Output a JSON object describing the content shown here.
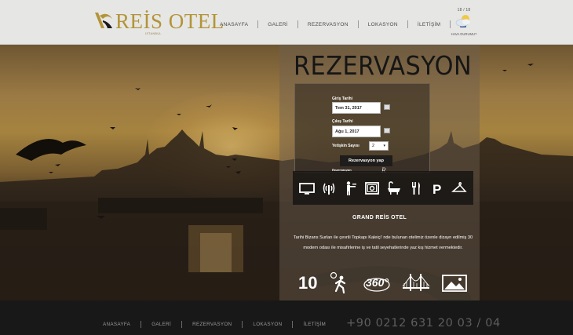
{
  "brand": {
    "logo_text": "REİS OTEL",
    "logo_sub": "ISTANBUL"
  },
  "nav": {
    "items": [
      "ANASAYFA",
      "GALERİ",
      "REZERVASYON",
      "LOKASYON",
      "İLETİŞİM"
    ],
    "facebook_icon": "facebook-icon"
  },
  "weather": {
    "temp": "18 / 18",
    "label": "HAVA DURUMU?",
    "icon": "partly-cloudy-icon"
  },
  "reservation": {
    "title": "REZERVASYON",
    "checkin_label": "Giriş Tarihi",
    "checkin_value": "Tem 31, 2017",
    "checkout_label": "Çıkış Tarihi",
    "checkout_value": "Ağu 1, 2017",
    "adults_label": "Yetişkin Sayısı",
    "adults_value": "2",
    "submit_label": "Rezervasyon yap",
    "powered_label": "Rezervasyon",
    "powered_brand": "R"
  },
  "amenities": [
    "tv-icon",
    "wifi-icon",
    "room-service-icon",
    "safe-icon",
    "bathtub-icon",
    "restaurant-icon",
    "parking-icon",
    "hanger-icon"
  ],
  "hotel": {
    "name": "GRAND REİS OTEL",
    "description": "Tarihi Bizans Surları ile çevrili Topkapı Kaleiçi' nde bulunan otelimiz özenle dizayn edilmiş 30 modern odası ile misafirlerine iş ve tatil seyehatlerinde yaz kış hizmet vermektedir."
  },
  "stats": {
    "walk_minutes": "10",
    "icons": [
      "walking-icon",
      "panorama-360-icon",
      "bridge-icon",
      "gallery-icon"
    ]
  },
  "footer": {
    "items": [
      "ANASAYFA",
      "GALERİ",
      "REZERVASYON",
      "LOKASYON",
      "İLETİŞİM"
    ],
    "phone": "+90 0212 631 20 03 / 04"
  },
  "colors": {
    "gold": "#b39439",
    "header_bg": "#e6e6e4",
    "footer_bg": "#181818",
    "facebook": "#3b5998"
  }
}
